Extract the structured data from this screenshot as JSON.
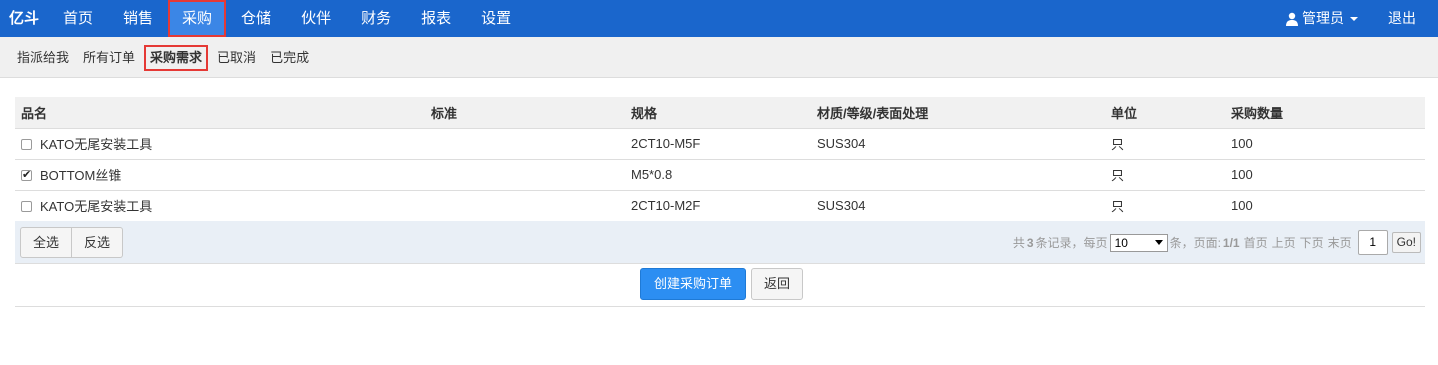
{
  "navbar": {
    "brand": "亿斗",
    "items": [
      {
        "label": "首页"
      },
      {
        "label": "销售"
      },
      {
        "label": "采购"
      },
      {
        "label": "仓储"
      },
      {
        "label": "伙伴"
      },
      {
        "label": "财务"
      },
      {
        "label": "报表"
      },
      {
        "label": "设置"
      }
    ],
    "active_index": 2,
    "user_label": "管理员",
    "logout_label": "退出"
  },
  "subnav": {
    "items": [
      {
        "label": "指派给我"
      },
      {
        "label": "所有订单"
      },
      {
        "label": "采购需求"
      },
      {
        "label": "已取消"
      },
      {
        "label": "已完成"
      }
    ],
    "active_index": 2
  },
  "table": {
    "headers": [
      "品名",
      "标准",
      "规格",
      "材质/等级/表面处理",
      "单位",
      "采购数量"
    ],
    "rows": [
      {
        "name": "KATO无尾安装工具",
        "standard": "",
        "spec": "2CT10-M5F",
        "material": "SUS304",
        "unit": "只",
        "qty": "100",
        "checked": false
      },
      {
        "name": "BOTTOM丝锥",
        "standard": "",
        "spec": "M5*0.8",
        "material": "",
        "unit": "只",
        "qty": "100",
        "checked": true
      },
      {
        "name": "KATO无尾安装工具",
        "standard": "",
        "spec": "2CT10-M2F",
        "material": "SUS304",
        "unit": "只",
        "qty": "100",
        "checked": false
      }
    ]
  },
  "footer": {
    "select_all": "全选",
    "invert": "反选",
    "pager": {
      "prefix": "共",
      "total": "3",
      "records_text": "条记录，每页",
      "page_size": "10",
      "per_text": "条，页面:",
      "page_info": "1/1",
      "first": "首页",
      "prev": "上页",
      "next": "下页",
      "last": "末页",
      "current_page": "1",
      "go": "Go!"
    }
  },
  "actions": {
    "create": "创建采购订单",
    "back": "返回"
  }
}
